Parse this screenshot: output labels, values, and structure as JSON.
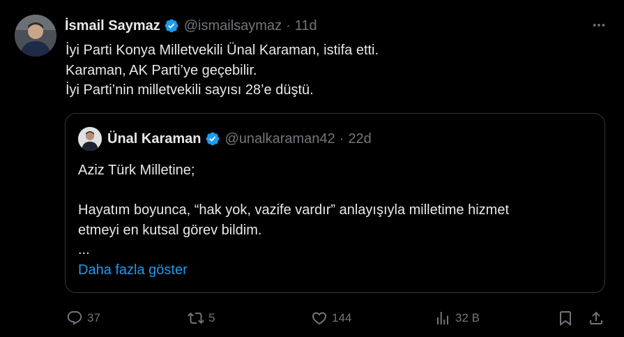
{
  "tweet": {
    "author_name": "İsmail Saymaz",
    "author_handle": "@ismailsaymaz",
    "separator": "·",
    "time": "11d",
    "lines": [
      "İyi Parti Konya Milletvekili Ünal Karaman, istifa etti.",
      "Karaman, AK Parti’ye geçebilir.",
      "İyi Parti’nin milletvekili sayısı 28’e düştü."
    ]
  },
  "quote": {
    "author_name": "Ünal Karaman",
    "author_handle": "@unalkaraman42",
    "separator": "·",
    "time": "22d",
    "lines": [
      "Aziz Türk Milletine;",
      "",
      "Hayatım boyunca, “hak yok, vazife vardır” anlayışıyla milletime hizmet",
      "etmeyi en kutsal görev bildim.",
      "..."
    ],
    "show_more_label": "Daha fazla göster"
  },
  "actions": {
    "replies": "37",
    "reposts": "5",
    "likes": "144",
    "views": "32 B"
  },
  "icons": {
    "more": "more-icon",
    "verified": "verified-badge-icon",
    "reply": "reply-icon",
    "repost": "repost-icon",
    "like": "like-icon",
    "views": "views-icon",
    "bookmark": "bookmark-icon",
    "share": "share-icon"
  },
  "colors": {
    "background": "#000000",
    "text": "#e7e9ea",
    "muted": "#71767b",
    "accent": "#1d9bf0",
    "border": "#333639"
  }
}
